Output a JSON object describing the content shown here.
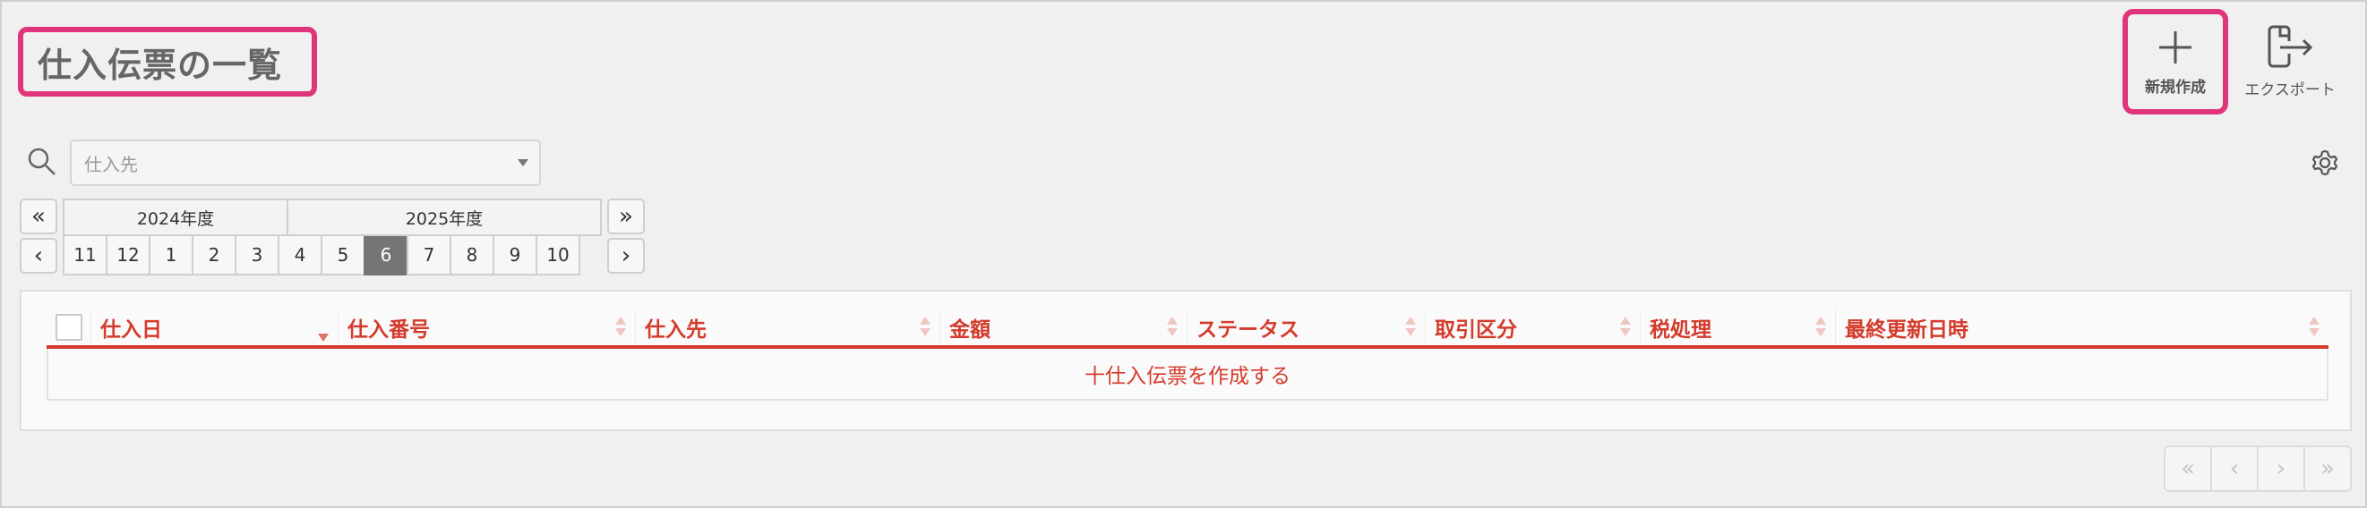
{
  "header": {
    "title": "仕入伝票の一覧"
  },
  "actions": {
    "new_label": "新規作成",
    "export_label": "エクスポート"
  },
  "filter": {
    "supplier_placeholder": "仕入先",
    "search_icon": "search-icon",
    "settings_icon": "gear-icon"
  },
  "period": {
    "prev_year": "«",
    "next_year": "»",
    "prev_month": "‹",
    "next_month": "›",
    "years": [
      "2024年度",
      "2025年度"
    ],
    "months": [
      "11",
      "12",
      "1",
      "2",
      "3",
      "4",
      "5",
      "6",
      "7",
      "8",
      "9",
      "10"
    ],
    "selected_month": "6"
  },
  "table": {
    "columns": [
      "仕入日",
      "仕入番号",
      "仕入先",
      "金額",
      "ステータス",
      "取引区分",
      "税処理",
      "最終更新日時"
    ],
    "empty_action": "十仕入伝票を作成する"
  },
  "pagination": {
    "first": "«",
    "prev": "‹",
    "next": "›",
    "last": "»"
  },
  "colors": {
    "accent": "#d43b2c",
    "highlight": "#e0357b",
    "selected_month_bg": "#757575"
  }
}
